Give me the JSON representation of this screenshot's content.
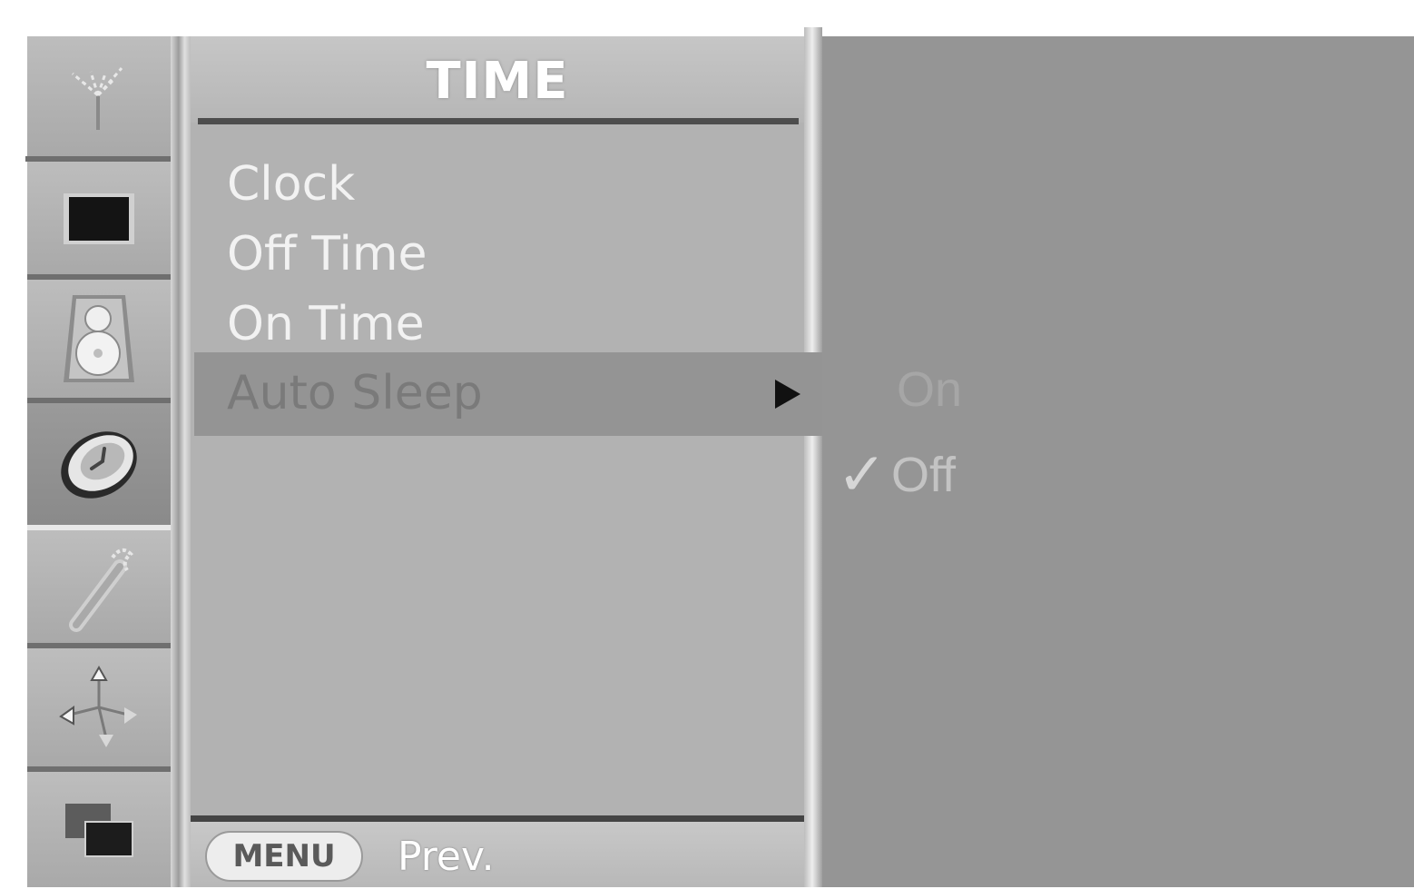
{
  "colors": {
    "sidebar_bg": "#b3b3b3",
    "menu_bg": "#b2b2b2",
    "selected_row": "#949494",
    "submenu_bg": "#959595",
    "separator": "#4d4d4d",
    "arrow": "#111111"
  },
  "sidebar": {
    "tabs": [
      {
        "icon": "antenna-icon",
        "active": false
      },
      {
        "icon": "picture-icon",
        "active": false
      },
      {
        "icon": "speaker-icon",
        "active": false
      },
      {
        "icon": "clock-icon",
        "active": true
      },
      {
        "icon": "wrench-icon",
        "active": false
      },
      {
        "icon": "arrows-icon",
        "active": false
      },
      {
        "icon": "input-icon",
        "active": false
      }
    ]
  },
  "menu": {
    "title": "TIME",
    "items": [
      {
        "label": "Clock"
      },
      {
        "label": "Off Time"
      },
      {
        "label": "On Time"
      },
      {
        "label": "Auto Sleep",
        "selected": true,
        "has_submenu": true
      }
    ]
  },
  "submenu": {
    "options": [
      {
        "label": "On",
        "checked": false
      },
      {
        "label": "Off",
        "checked": true
      }
    ],
    "check_mark": "✓"
  },
  "footer": {
    "menu_key": "MENU",
    "prev_label": "Prev."
  }
}
